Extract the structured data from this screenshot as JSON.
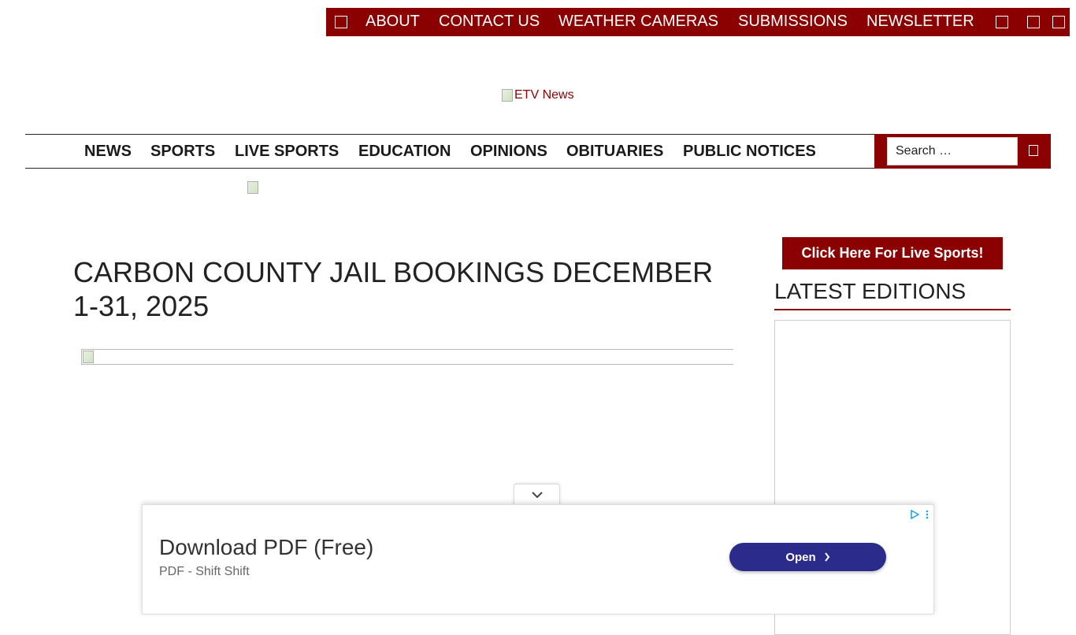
{
  "topbar": {
    "links": [
      "ABOUT",
      "CONTACT US",
      "WEATHER CAMERAS",
      "SUBMISSIONS",
      "NEWSLETTER"
    ]
  },
  "logo": {
    "alt": "ETV News"
  },
  "nav": {
    "items": [
      "NEWS",
      "SPORTS",
      "LIVE SPORTS",
      "EDUCATION",
      "OPINIONS",
      "OBITUARIES",
      "PUBLIC NOTICES"
    ]
  },
  "search": {
    "placeholder": "Search …"
  },
  "article": {
    "title": "CARBON COUNTY JAIL BOOKINGS DECEMBER 1-31, 2025"
  },
  "sidebar": {
    "live_button": "Click Here For Live Sports!",
    "latest_title": "LATEST EDITIONS"
  },
  "ad": {
    "title": "Download PDF (Free)",
    "subtitle": "PDF - Shift Shift",
    "button": "Open"
  },
  "colors": {
    "brand": "#8b0000",
    "ad_button": "#2b2b8c"
  }
}
